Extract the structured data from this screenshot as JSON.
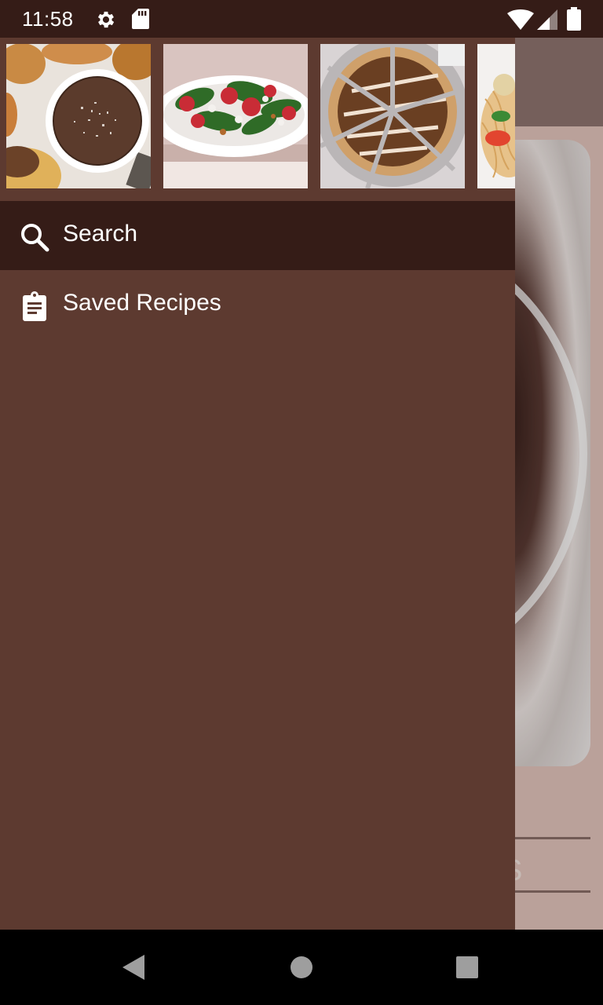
{
  "status_bar": {
    "time": "11:58",
    "icons": [
      "settings-icon",
      "sd-card-icon",
      "wifi-icon",
      "signal-icon",
      "battery-icon"
    ]
  },
  "drawer": {
    "header_images": [
      "chocolate-mousse-image",
      "strawberry-spinach-salad-image",
      "chocolate-tart-image",
      "spaghetti-dish-image"
    ],
    "items": [
      {
        "label": "Search",
        "icon": "search-icon",
        "selected": true
      },
      {
        "label": "Saved Recipes",
        "icon": "clipboard-icon",
        "selected": false
      }
    ]
  },
  "background": {
    "tab_label_fragment": "S"
  },
  "colors": {
    "status_bar": "#351c17",
    "drawer": "#5d3a30",
    "selected_row": "#351c17",
    "background_app": "#e3c5bc",
    "background_appbar": "#8f7570"
  },
  "nav_bar": {
    "buttons": [
      "back-button",
      "home-button",
      "recents-button"
    ]
  }
}
